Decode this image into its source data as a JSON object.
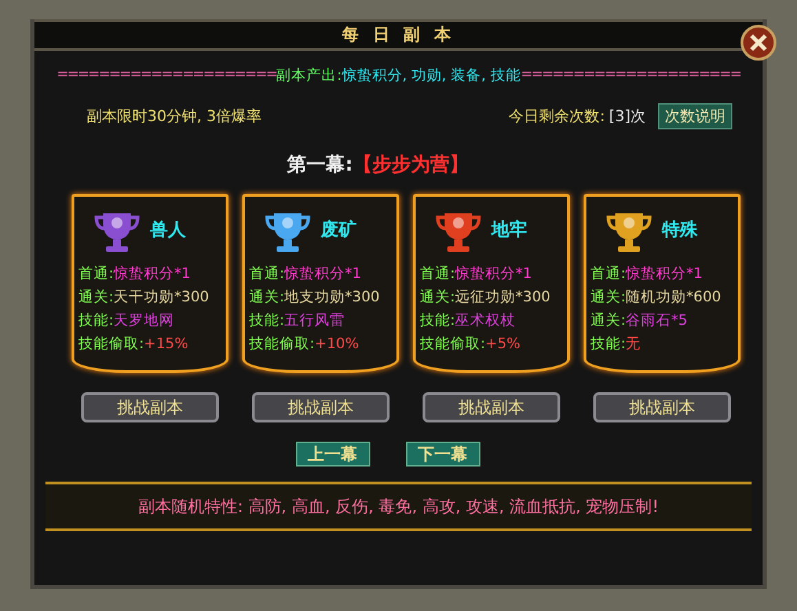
{
  "window": {
    "title": "每 日 副 本"
  },
  "output_line": {
    "left_rule": "=====================",
    "label": "副本产出:",
    "items": "惊蛰积分, 功勋, 装备, 技能",
    "right_rule": "====================="
  },
  "info": {
    "time_limit": "副本限时30分钟, 3倍爆率",
    "remaining_label": "今日剩余次数:",
    "remaining_value": "[3]次",
    "help_button": "次数说明"
  },
  "act": {
    "label": "第一幕:",
    "name": "【步步为营】"
  },
  "dungeons": [
    {
      "name": "兽人",
      "color": "#8a4fd0",
      "lines": [
        {
          "label": "首通:",
          "value": "惊蛰积分*1",
          "color": "#ff3ccf"
        },
        {
          "label": "通关:",
          "value": "天干功勋*300",
          "color": "#e6d7a0"
        },
        {
          "label": "技能:",
          "value": "天罗地网",
          "color": "#e040e0"
        },
        {
          "label": "技能偷取:",
          "value": "+15%",
          "color": "#ff4a4a"
        }
      ],
      "button": "挑战副本"
    },
    {
      "name": "废矿",
      "color": "#4aa8f0",
      "lines": [
        {
          "label": "首通:",
          "value": "惊蛰积分*1",
          "color": "#ff3ccf"
        },
        {
          "label": "通关:",
          "value": "地支功勋*300",
          "color": "#e6d7a0"
        },
        {
          "label": "技能:",
          "value": "五行风雷",
          "color": "#e040e0"
        },
        {
          "label": "技能偷取:",
          "value": "+10%",
          "color": "#ff4a4a"
        }
      ],
      "button": "挑战副本"
    },
    {
      "name": "地牢",
      "color": "#e04020",
      "lines": [
        {
          "label": "首通:",
          "value": "惊蛰积分*1",
          "color": "#ff3ccf"
        },
        {
          "label": "通关:",
          "value": "远征功勋*300",
          "color": "#e6d7a0"
        },
        {
          "label": "技能:",
          "value": "巫术权杖",
          "color": "#e040e0"
        },
        {
          "label": "技能偷取:",
          "value": "+5%",
          "color": "#ff4a4a"
        }
      ],
      "button": "挑战副本"
    },
    {
      "name": "特殊",
      "color": "#e0a020",
      "lines": [
        {
          "label": "首通:",
          "value": "惊蛰积分*1",
          "color": "#ff3ccf"
        },
        {
          "label": "通关:",
          "value": "随机功勋*600",
          "color": "#e6d7a0"
        },
        {
          "label": "通关:",
          "value": "谷雨石*5",
          "color": "#e040e0"
        },
        {
          "label": "技能:",
          "value": "无",
          "color": "#ff4a4a"
        }
      ],
      "button": "挑战副本"
    }
  ],
  "nav": {
    "prev": "上一幕",
    "next": "下一幕"
  },
  "traits": "副本随机特性: 高防, 高血, 反伤, 毒免, 高攻, 攻速, 流血抵抗, 宠物压制!"
}
